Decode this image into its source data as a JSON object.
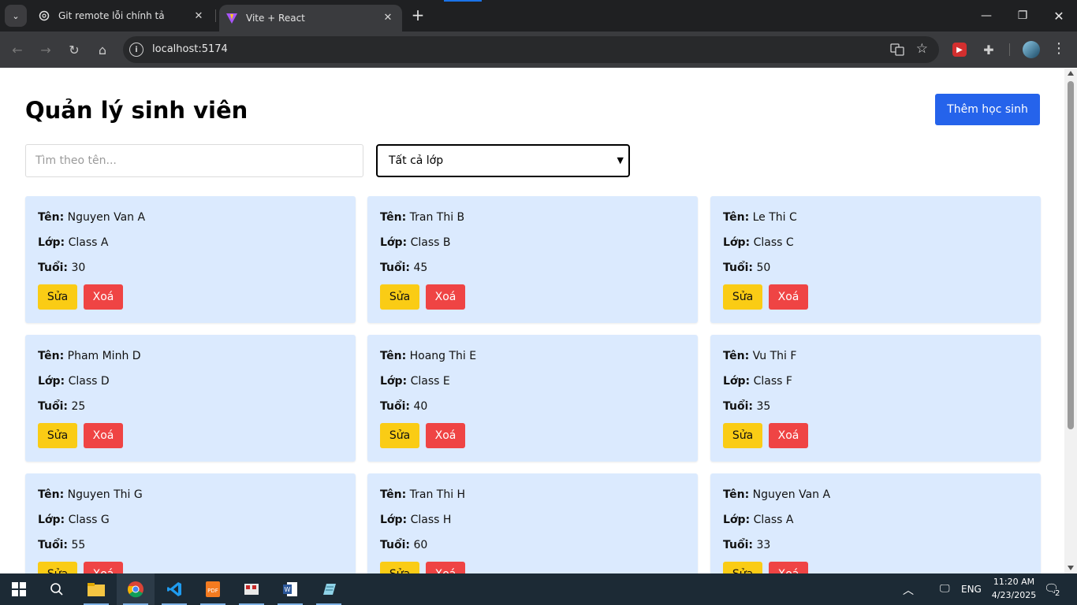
{
  "browser": {
    "tabs": [
      {
        "title": "Git remote lỗi chính tả",
        "active": false
      },
      {
        "title": "Vite + React",
        "active": true
      }
    ],
    "url": "localhost:5174"
  },
  "app": {
    "title": "Quản lý sinh viên",
    "add_button": "Thêm học sinh",
    "search_placeholder": "Tìm theo tên...",
    "class_filter": "Tất cả lớp",
    "labels": {
      "name": "Tên:",
      "class": "Lớp:",
      "age": "Tuổi:"
    },
    "edit_label": "Sửa",
    "delete_label": "Xoá",
    "students": [
      {
        "name": "Nguyen Van A",
        "class": "Class A",
        "age": "30"
      },
      {
        "name": "Tran Thi B",
        "class": "Class B",
        "age": "45"
      },
      {
        "name": "Le Thi C",
        "class": "Class C",
        "age": "50"
      },
      {
        "name": "Pham Minh D",
        "class": "Class D",
        "age": "25"
      },
      {
        "name": "Hoang Thi E",
        "class": "Class E",
        "age": "40"
      },
      {
        "name": "Vu Thi F",
        "class": "Class F",
        "age": "35"
      },
      {
        "name": "Nguyen Thi G",
        "class": "Class G",
        "age": "55"
      },
      {
        "name": "Tran Thi H",
        "class": "Class H",
        "age": "60"
      },
      {
        "name": "Nguyen Van A",
        "class": "Class A",
        "age": "33"
      }
    ]
  },
  "taskbar": {
    "language": "ENG",
    "time": "11:20 AM",
    "date": "4/23/2025",
    "notification_count": "2"
  },
  "colors": {
    "card_bg": "#dbeafe",
    "primary": "#2563eb",
    "edit": "#facc15",
    "delete": "#ef4444"
  }
}
